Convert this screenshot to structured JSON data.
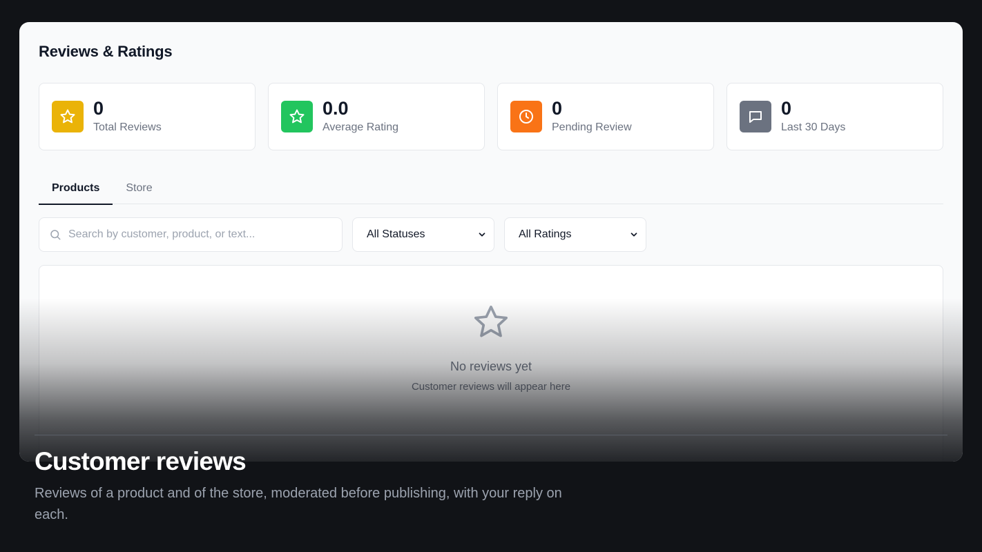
{
  "page": {
    "title": "Reviews & Ratings"
  },
  "stats": [
    {
      "value": "0",
      "label": "Total Reviews",
      "icon": "star-icon",
      "color": "#eab308"
    },
    {
      "value": "0.0",
      "label": "Average Rating",
      "icon": "star-icon",
      "color": "#22c55e"
    },
    {
      "value": "0",
      "label": "Pending Review",
      "icon": "clock-icon",
      "color": "#f97316"
    },
    {
      "value": "0",
      "label": "Last 30 Days",
      "icon": "message-icon",
      "color": "#6b7280"
    }
  ],
  "tabs": [
    {
      "label": "Products",
      "active": true
    },
    {
      "label": "Store",
      "active": false
    }
  ],
  "filters": {
    "search_placeholder": "Search by customer, product, or text...",
    "status_selected": "All Statuses",
    "rating_selected": "All Ratings"
  },
  "empty": {
    "title": "No reviews yet",
    "subtitle": "Customer reviews will appear here"
  },
  "caption": {
    "title": "Customer reviews",
    "text": "Reviews of a product and of the store, moderated before publishing, with your reply on each."
  }
}
